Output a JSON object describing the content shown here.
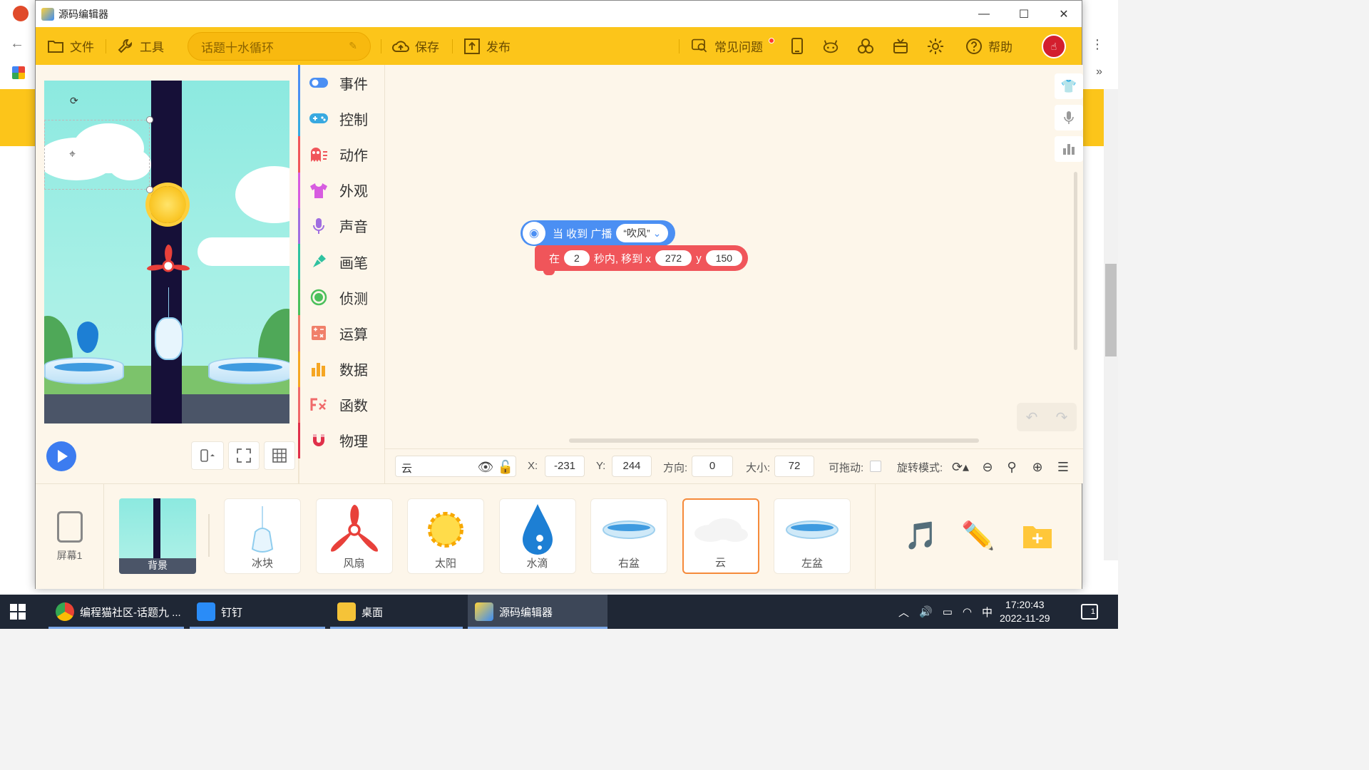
{
  "window": {
    "title": "源码编辑器"
  },
  "toolbar": {
    "file": "文件",
    "tools": "工具",
    "project_name": "话题十水循环",
    "save": "保存",
    "publish": "发布",
    "faq": "常见问题",
    "help": "帮助"
  },
  "categories": [
    {
      "label": "事件",
      "color": "#4b8ff3",
      "icon": "toggle-icon"
    },
    {
      "label": "控制",
      "color": "#38a9e0",
      "icon": "gamepad-icon"
    },
    {
      "label": "动作",
      "color": "#f0555a",
      "icon": "ghost-icon"
    },
    {
      "label": "外观",
      "color": "#d75ce0",
      "icon": "shirt-icon"
    },
    {
      "label": "声音",
      "color": "#a06ee0",
      "icon": "mic-icon"
    },
    {
      "label": "画笔",
      "color": "#2fc2a0",
      "icon": "brush-icon"
    },
    {
      "label": "侦测",
      "color": "#4bc05c",
      "icon": "detect-icon"
    },
    {
      "label": "运算",
      "color": "#f0806a",
      "icon": "calc-icon"
    },
    {
      "label": "数据",
      "color": "#f5a623",
      "icon": "chart-icon"
    },
    {
      "label": "函数",
      "color": "#f06a6a",
      "icon": "function-icon"
    },
    {
      "label": "物理",
      "color": "#e0304a",
      "icon": "magnet-icon"
    }
  ],
  "blocks": {
    "hat": {
      "prefix": "当 收到 广播",
      "message": "“吹风”",
      "dropdown": "⌄"
    },
    "motion": {
      "w1": "在",
      "seconds": "2",
      "w2": "秒内, 移到 x",
      "x": "272",
      "w3": "y",
      "y": "150"
    }
  },
  "properties": {
    "sprite_name": "云",
    "x_label": "X:",
    "x": "-231",
    "y_label": "Y:",
    "y": "244",
    "direction_label": "方向:",
    "direction": "0",
    "size_label": "大小:",
    "size": "72",
    "draggable_label": "可拖动:",
    "rotation_label": "旋转模式:"
  },
  "screen": {
    "label": "屏幕1"
  },
  "background_thumb": {
    "label": "背景"
  },
  "sprites": [
    {
      "label": "冰块"
    },
    {
      "label": "风扇"
    },
    {
      "label": "太阳"
    },
    {
      "label": "水滴"
    },
    {
      "label": "右盆"
    },
    {
      "label": "云",
      "selected": true
    },
    {
      "label": "左盆"
    }
  ],
  "taskbar": {
    "tasks": [
      {
        "label": "编程猫社区-话题九 ...",
        "icon": "chrome-icon"
      },
      {
        "label": "钉钉",
        "icon": "dingtalk-icon"
      },
      {
        "label": "桌面",
        "icon": "folder-icon"
      },
      {
        "label": "源码编辑器",
        "icon": "codemao-icon"
      }
    ],
    "ime": "中",
    "time": "17:20:43",
    "date": "2022-11-29",
    "notifications": "1"
  }
}
